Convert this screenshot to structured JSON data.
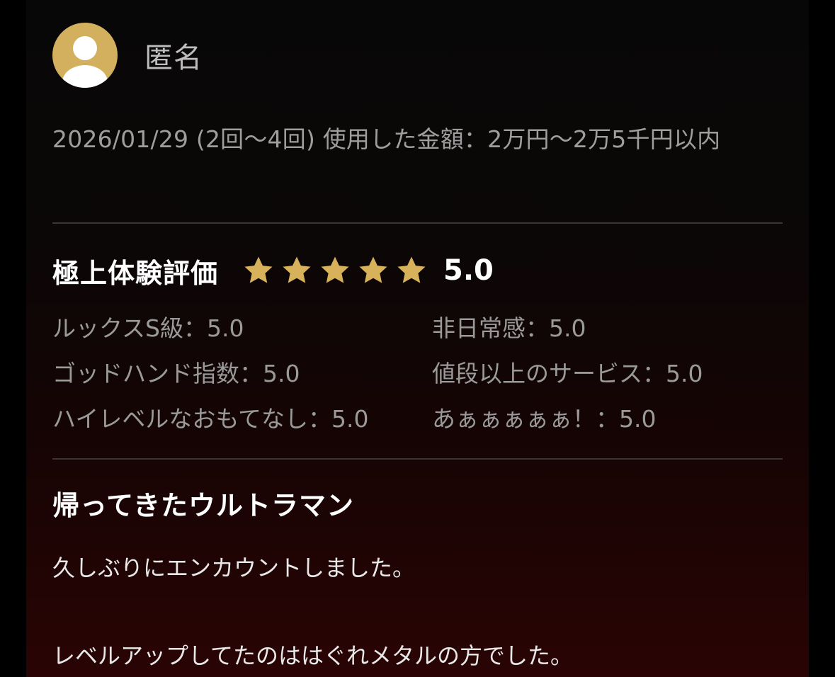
{
  "review": {
    "user": {
      "name": "匿名",
      "avatar_icon": "user-avatar-icon",
      "avatar_color": "#d3b05e"
    },
    "meta": "2026/01/29 (2回〜4回) 使用した金額：2万円〜2万5千円以内",
    "rating": {
      "title": "極上体験評価",
      "stars": 5,
      "max_stars": 5,
      "star_icon": "star-icon",
      "star_color": "#d7b25a",
      "score": "5.0"
    },
    "sub_ratings": [
      {
        "label": "ルックスS級：5.0"
      },
      {
        "label": "非日常感：5.0"
      },
      {
        "label": "ゴッドハンド指数：5.0"
      },
      {
        "label": "値段以上のサービス：5.0"
      },
      {
        "label": "ハイレベルなおもてなし：5.0"
      },
      {
        "label": "あぁぁぁぁぁ！：5.0"
      }
    ],
    "title": "帰ってきたウルトラマン",
    "body": [
      "久しぶりにエンカウントしました。",
      "",
      "レベルアップしてたのははぐれメタルの方でした。"
    ]
  }
}
